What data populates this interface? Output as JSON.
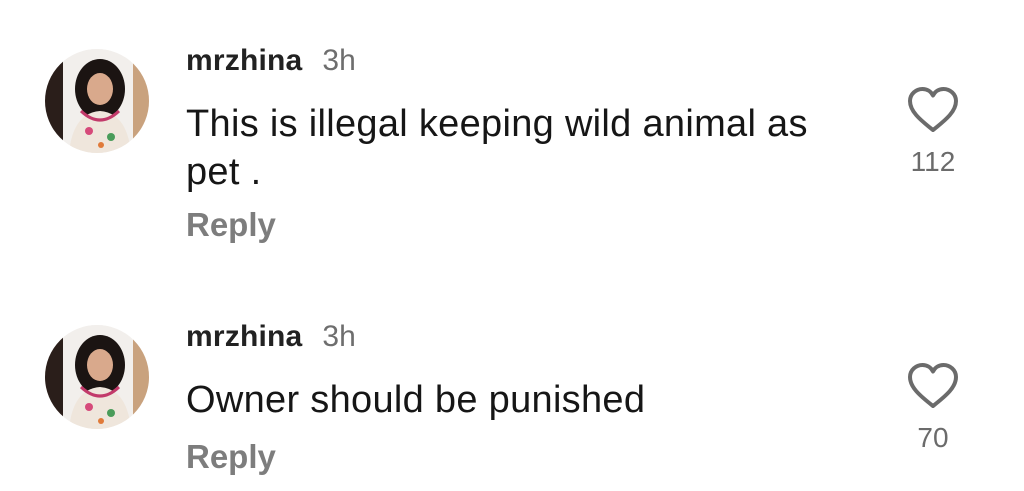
{
  "comments": [
    {
      "username": "mrzhina",
      "time": "3h",
      "text": "This is illegal keeping wild animal as pet .",
      "reply_label": "Reply",
      "likes": "112",
      "like_icon": "heart-outline-icon"
    },
    {
      "username": "mrzhina",
      "time": "3h",
      "text": "Owner should be punished",
      "reply_label": "Reply",
      "likes": "70",
      "like_icon": "heart-outline-icon"
    }
  ],
  "colors": {
    "username": "#222222",
    "text": "#161616",
    "muted": "#6e6e6e",
    "reply": "#7d7d7d"
  }
}
